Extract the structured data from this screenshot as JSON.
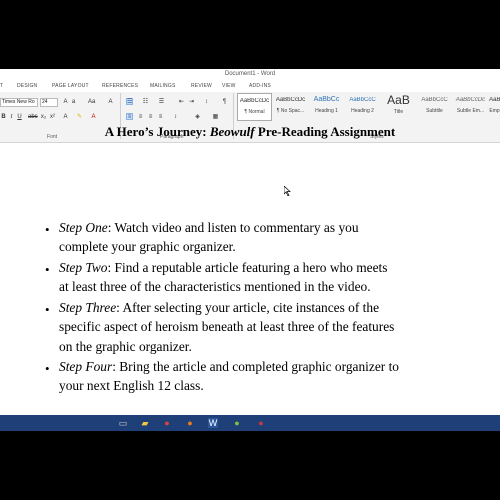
{
  "app": {
    "document_title": "Document1 - Word"
  },
  "ribbon_tabs": [
    "T",
    "DESIGN",
    "PAGE LAYOUT",
    "REFERENCES",
    "MAILINGS",
    "REVIEW",
    "VIEW",
    "ADD-INS"
  ],
  "font": {
    "family": "Times New Ro",
    "size": "24"
  },
  "groups": {
    "font": "Font",
    "paragraph": "Paragraph",
    "styles": "Styles"
  },
  "styles": [
    {
      "preview": "AaBbCcDc",
      "name": "¶ Normal"
    },
    {
      "preview": "AaBbCcDc",
      "name": "¶ No Spac..."
    },
    {
      "preview": "AaBbCc",
      "name": "Heading 1"
    },
    {
      "preview": "AaBbCcC",
      "name": "Heading 2"
    },
    {
      "preview": "AaB",
      "name": "Title"
    },
    {
      "preview": "AaBbCcC",
      "name": "Subtitle"
    },
    {
      "preview": "AaBbCcDc",
      "name": "Subtle Em..."
    },
    {
      "preview": "AaBb",
      "name": "Emp"
    }
  ],
  "document": {
    "heading_pre": "A Hero’s Journey: ",
    "heading_em": "Beowulf",
    "heading_post": " Pre-Reading Assignment",
    "bullet_char": "•",
    "steps": [
      {
        "label": "Step One",
        "line1": ": Watch video and listen to commentary as you",
        "line2": "complete your graphic organizer."
      },
      {
        "label": "Step Two",
        "line1": ": Find a reputable article featuring a hero who meets",
        "line2": "at least three of the characteristics mentioned in the video."
      },
      {
        "label": "Step Three",
        "line1": ": After selecting your article, cite instances of the",
        "line2": "specific aspect of heroism beneath at least three of the features",
        "line3": "on the graphic organizer."
      },
      {
        "label": "Step Four",
        "line1": ": Bring the article and completed graphic organizer to",
        "line2": "your next English 12 class."
      }
    ]
  },
  "colors": {
    "ribbon_bg": "#f3f3f3",
    "word_blue": "#2b579a",
    "taskbar": "#1e3f78"
  }
}
